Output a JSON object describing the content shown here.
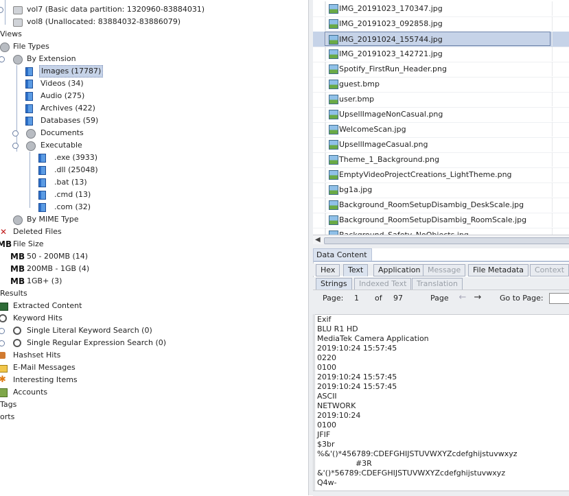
{
  "tree": {
    "vol7": "vol7 (Basic data partition: 1320960-83884031)",
    "vol8": "vol8 (Unallocated: 83884032-83886079)",
    "views": "Views",
    "file_types": "File Types",
    "by_extension": "By Extension",
    "images": "Images (17787)",
    "videos": "Videos (34)",
    "audio": "Audio (275)",
    "archives": "Archives (422)",
    "databases": "Databases (59)",
    "documents": "Documents",
    "executable": "Executable",
    "exe": ".exe (3933)",
    "dll": ".dll (25048)",
    "bat": ".bat (13)",
    "cmd": ".cmd (13)",
    "com": ".com (32)",
    "by_mime": "By MIME Type",
    "deleted": "Deleted Files",
    "file_size": "File Size",
    "size_icon_text": "MB",
    "size1": "50 - 200MB (14)",
    "size2": "200MB - 1GB (4)",
    "size3": "1GB+ (3)",
    "results": "Results",
    "extracted": "Extracted Content",
    "keyword_hits": "Keyword Hits",
    "literal": "Single Literal Keyword Search (0)",
    "regex": "Single Regular Expression Search (0)",
    "hashset": "Hashset Hits",
    "email": "E-Mail Messages",
    "interesting": "Interesting Items",
    "accounts": "Accounts",
    "tags": "Tags",
    "reports": "orts"
  },
  "files": [
    "IMG_20191023_170347.jpg",
    "IMG_20191023_092858.jpg",
    "IMG_20191024_155744.jpg",
    "IMG_20191023_142721.jpg",
    "Spotify_FirstRun_Header.png",
    "guest.bmp",
    "user.bmp",
    "UpsellImageNonCasual.png",
    "WelcomeScan.jpg",
    "UpsellImageCasual.png",
    "Theme_1_Background.png",
    "EmptyVideoProjectCreations_LightTheme.png",
    "bg1a.jpg",
    "Background_RoomSetupDisambig_DeskScale.jpg",
    "Background_RoomSetupDisambig_RoomScale.jpg",
    "Background_Safety_NoObjects.jpg"
  ],
  "data_content": {
    "title": "Data Content",
    "tabs": [
      "Hex",
      "Text",
      "Application",
      "Message",
      "File Metadata",
      "Context"
    ],
    "subtabs": [
      "Strings",
      "Indexed Text",
      "Translation"
    ],
    "page_label": "Page:",
    "page_value": "1",
    "of_label": "of",
    "total_pages": "97",
    "page_nav_label": "Page",
    "goto_label": "Go to Page:",
    "text_lines": [
      "Exif",
      "BLU R1 HD",
      "MediaTek Camera Application",
      "2019:10:24 15:57:45",
      "0220",
      "0100",
      "2019:10:24 15:57:45",
      "2019:10:24 15:57:45",
      "ASCII",
      "NETWORK",
      "2019:10:24",
      "0100",
      "JFIF",
      "$3br",
      "%&'()*456789:CDEFGHIJSTUVWXYZcdefghijstuvwxyz",
      "                #3R",
      "&'()*56789:CDEFGHIJSTUVWXYZcdefghijstuvwxyz",
      "Q4w-"
    ]
  }
}
